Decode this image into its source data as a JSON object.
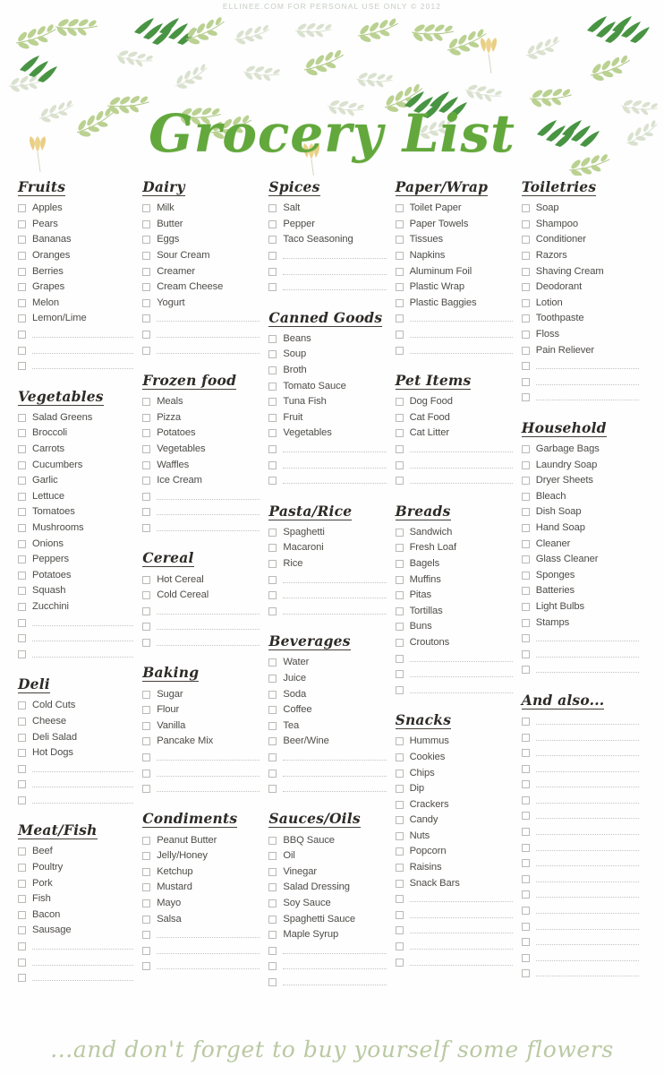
{
  "credit": "ELLINEE.COM FOR PERSONAL USE ONLY © 2012",
  "header": {
    "title": "Grocery List",
    "accent_green": "#63a83c",
    "leaf_green_dark": "#3f8f3a",
    "leaf_green_light": "#b9cf8e",
    "leaf_sage": "#cdd9bd",
    "flower_yellow": "#ecd288"
  },
  "footer": {
    "text": "...and don't forget to buy yourself some flowers",
    "color": "#b9c9a2"
  },
  "columns": [
    {
      "sections": [
        {
          "title": "Fruits",
          "items": [
            "Apples",
            "Pears",
            "Bananas",
            "Oranges",
            "Berries",
            "Grapes",
            "Melon",
            "Lemon/Lime"
          ],
          "blanks": 3
        },
        {
          "title": "Vegetables",
          "items": [
            "Salad Greens",
            "Broccoli",
            "Carrots",
            "Cucumbers",
            "Garlic",
            "Lettuce",
            "Tomatoes",
            "Mushrooms",
            "Onions",
            "Peppers",
            "Potatoes",
            "Squash",
            "Zucchini"
          ],
          "blanks": 3
        },
        {
          "title": "Deli",
          "items": [
            "Cold Cuts",
            "Cheese",
            "Deli Salad",
            "Hot Dogs"
          ],
          "blanks": 3
        },
        {
          "title": "Meat/Fish",
          "items": [
            "Beef",
            "Poultry",
            "Pork",
            "Fish",
            "Bacon",
            "Sausage"
          ],
          "blanks": 3
        }
      ]
    },
    {
      "sections": [
        {
          "title": "Dairy",
          "items": [
            "Milk",
            "Butter",
            "Eggs",
            "Sour Cream",
            "Creamer",
            "Cream Cheese",
            "Yogurt"
          ],
          "blanks": 3
        },
        {
          "title": "Frozen food",
          "items": [
            "Meals",
            "Pizza",
            "Potatoes",
            "Vegetables",
            "Waffles",
            "Ice Cream"
          ],
          "blanks": 3
        },
        {
          "title": "Cereal",
          "items": [
            "Hot Cereal",
            "Cold Cereal"
          ],
          "blanks": 3
        },
        {
          "title": "Baking",
          "items": [
            "Sugar",
            "Flour",
            "Vanilla",
            "Pancake Mix"
          ],
          "blanks": 3
        },
        {
          "title": "Condiments",
          "items": [
            "Peanut Butter",
            "Jelly/Honey",
            "Ketchup",
            "Mustard",
            "Mayo",
            "Salsa"
          ],
          "blanks": 3
        }
      ]
    },
    {
      "sections": [
        {
          "title": "Spices",
          "items": [
            "Salt",
            "Pepper",
            "Taco Seasoning"
          ],
          "blanks": 3
        },
        {
          "title": "Canned Goods",
          "items": [
            "Beans",
            "Soup",
            "Broth",
            "Tomato Sauce",
            "Tuna Fish",
            "Fruit",
            "Vegetables"
          ],
          "blanks": 3
        },
        {
          "title": "Pasta/Rice",
          "items": [
            "Spaghetti",
            "Macaroni",
            "Rice"
          ],
          "blanks": 3
        },
        {
          "title": "Beverages",
          "items": [
            "Water",
            "Juice",
            "Soda",
            "Coffee",
            "Tea",
            "Beer/Wine"
          ],
          "blanks": 3
        },
        {
          "title": "Sauces/Oils",
          "items": [
            "BBQ Sauce",
            "Oil",
            "Vinegar",
            "Salad Dressing",
            "Soy Sauce",
            "Spaghetti Sauce",
            "Maple Syrup"
          ],
          "blanks": 3
        }
      ]
    },
    {
      "sections": [
        {
          "title": "Paper/Wrap",
          "items": [
            "Toilet Paper",
            "Paper Towels",
            "Tissues",
            "Napkins",
            "Aluminum Foil",
            "Plastic Wrap",
            "Plastic Baggies"
          ],
          "blanks": 3
        },
        {
          "title": "Pet Items",
          "items": [
            "Dog Food",
            "Cat Food",
            "Cat Litter"
          ],
          "blanks": 3
        },
        {
          "title": "Breads",
          "items": [
            "Sandwich",
            "Fresh Loaf",
            "Bagels",
            "Muffins",
            "Pitas",
            "Tortillas",
            "Buns",
            "Croutons"
          ],
          "blanks": 3
        },
        {
          "title": "Snacks",
          "items": [
            "Hummus",
            "Cookies",
            "Chips",
            "Dip",
            "Crackers",
            "Candy",
            "Nuts",
            "Popcorn",
            "Raisins",
            "Snack Bars"
          ],
          "blanks": 5
        }
      ]
    },
    {
      "sections": [
        {
          "title": "Toiletries",
          "items": [
            "Soap",
            "Shampoo",
            "Conditioner",
            "Razors",
            "Shaving Cream",
            "Deodorant",
            "Lotion",
            "Toothpaste",
            "Floss",
            "Pain Reliever"
          ],
          "blanks": 3
        },
        {
          "title": "Household",
          "items": [
            "Garbage Bags",
            "Laundry Soap",
            "Dryer Sheets",
            "Bleach",
            "Dish Soap",
            "Hand Soap",
            "Cleaner",
            "Glass Cleaner",
            "Sponges",
            "Batteries",
            "Light Bulbs",
            "Stamps"
          ],
          "blanks": 3
        },
        {
          "title": "And also...",
          "items": [],
          "blanks": 17
        }
      ]
    }
  ]
}
